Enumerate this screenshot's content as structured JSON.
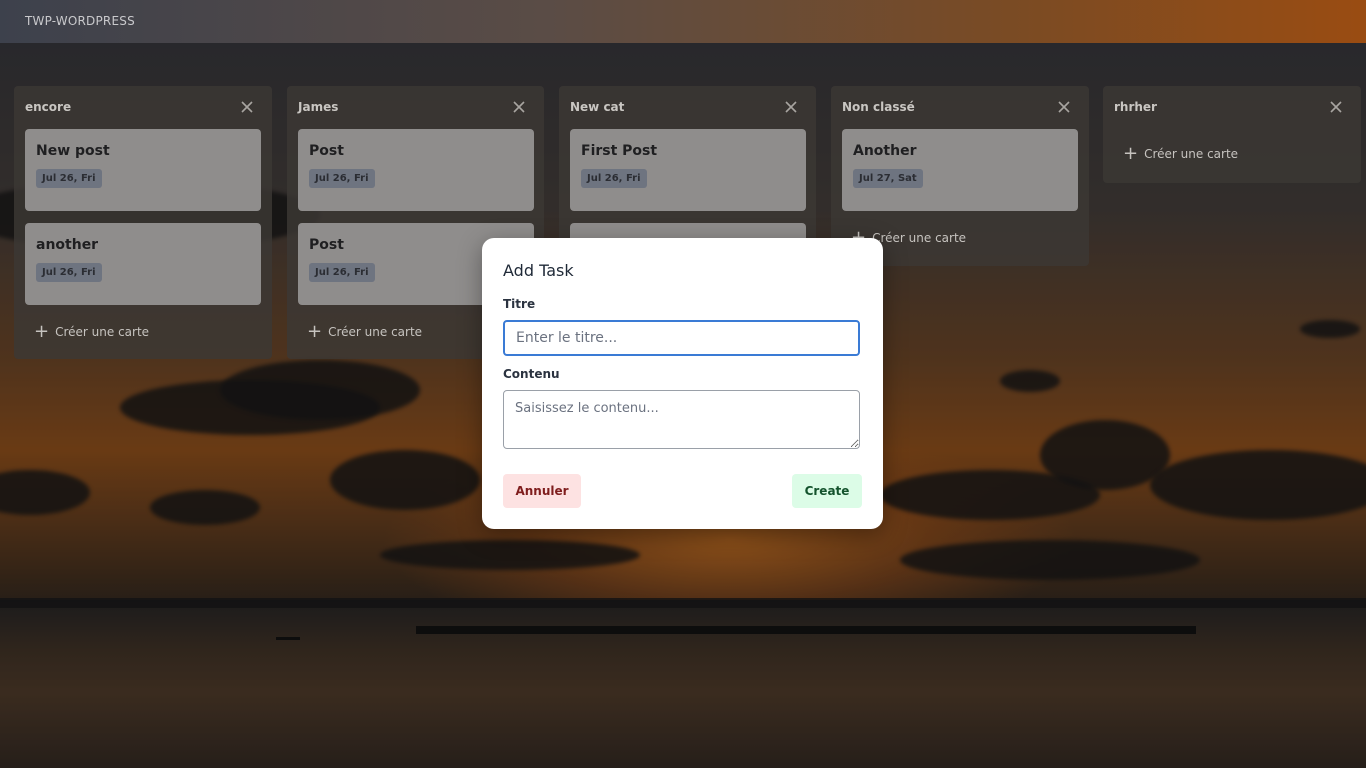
{
  "app": {
    "brand": "TWP-WORDPRESS"
  },
  "board": {
    "add_card_label": "Créer une carte",
    "columns": [
      {
        "title": "encore",
        "cards": [
          {
            "title": "New post",
            "date": "Jul 26, Fri"
          },
          {
            "title": "another",
            "date": "Jul 26, Fri"
          }
        ]
      },
      {
        "title": "James",
        "cards": [
          {
            "title": "Post",
            "date": "Jul 26, Fri"
          },
          {
            "title": "Post",
            "date": "Jul 26, Fri"
          }
        ]
      },
      {
        "title": "New cat",
        "cards": [
          {
            "title": "First Post",
            "date": "Jul 26, Fri"
          }
        ]
      },
      {
        "title": "Non classé",
        "cards": [
          {
            "title": "Another",
            "date": "Jul 27, Sat"
          }
        ]
      },
      {
        "title": "rhrher",
        "cards": []
      }
    ]
  },
  "modal": {
    "title": "Add Task",
    "title_label": "Titre",
    "title_placeholder": "Enter le titre...",
    "title_value": "",
    "content_label": "Contenu",
    "content_placeholder": "Saisissez le contenu...",
    "content_value": "",
    "cancel_label": "Annuler",
    "create_label": "Create"
  },
  "colors": {
    "input_focus": "#3a7bd5",
    "cancel_bg": "#fde2e2",
    "cancel_text": "#7f1d1d",
    "create_bg": "#dcfce7",
    "create_text": "#14532d"
  }
}
